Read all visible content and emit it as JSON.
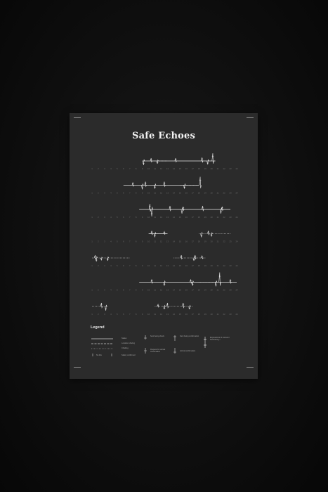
{
  "poster": {
    "title": "Safe Echoes",
    "background": "#2b2b2b",
    "ink": "#e8e8e8",
    "dim": "#6f6f6f"
  },
  "day_numbers": [
    "1",
    "2",
    "3",
    "4",
    "5",
    "6",
    "7",
    "8",
    "9",
    "10",
    "11",
    "12",
    "13",
    "14",
    "15",
    "16",
    "17",
    "18",
    "19",
    "20",
    "21",
    "22",
    "23",
    "24"
  ],
  "rows": [
    {
      "segments": [
        [
          9,
          20.6,
          "solid"
        ],
        [
          11,
          13,
          "dotted"
        ]
      ],
      "spikes": [
        [
          9.2,
          6
        ],
        [
          10.4,
          -4
        ],
        [
          11.4,
          4
        ],
        [
          14.3,
          -4
        ],
        [
          18.5,
          -5
        ],
        [
          19.4,
          5
        ],
        [
          20.2,
          -11
        ]
      ]
    },
    {
      "segments": [
        [
          6,
          18,
          "solid"
        ],
        [
          15,
          18,
          "dotted"
        ]
      ],
      "spikes": [
        [
          7.5,
          -4
        ],
        [
          9,
          6
        ],
        [
          9.5,
          -5
        ],
        [
          11,
          5
        ],
        [
          12.5,
          -5
        ],
        [
          15.7,
          5
        ],
        [
          18.2,
          -12
        ]
      ]
    },
    {
      "segments": [
        [
          8.5,
          23,
          "solid"
        ]
      ],
      "spikes": [
        [
          10.2,
          -8
        ],
        [
          10.5,
          10
        ],
        [
          13.4,
          -5
        ],
        [
          15.3,
          6
        ],
        [
          15.5,
          -4
        ],
        [
          18.6,
          -5
        ],
        [
          21.5,
          6
        ],
        [
          21.7,
          -4
        ]
      ]
    },
    {
      "segments": [
        [
          10,
          13,
          "solid"
        ],
        [
          18,
          23,
          "dotted"
        ]
      ],
      "spikes": [
        [
          10.5,
          -4
        ],
        [
          11,
          5
        ],
        [
          12.5,
          -3
        ],
        [
          18.4,
          5
        ],
        [
          19.5,
          -4
        ],
        [
          20,
          4
        ]
      ]
    },
    {
      "segments": [
        [
          1,
          7,
          "dotted"
        ],
        [
          14,
          19,
          "dotted"
        ]
      ],
      "spikes": [
        [
          1.5,
          -4
        ],
        [
          1.7,
          5
        ],
        [
          2.5,
          3
        ],
        [
          3.5,
          4
        ],
        [
          15.2,
          -4
        ],
        [
          17.2,
          4
        ],
        [
          17.4,
          -4
        ],
        [
          18.5,
          -3
        ]
      ]
    },
    {
      "segments": [
        [
          8.5,
          24,
          "solid"
        ],
        [
          18,
          21,
          "dotted"
        ]
      ],
      "spikes": [
        [
          10.5,
          -4
        ],
        [
          12.5,
          5
        ],
        [
          16.7,
          -4
        ],
        [
          17,
          5
        ],
        [
          20.7,
          6
        ],
        [
          21.3,
          -14
        ],
        [
          23,
          -4
        ]
      ]
    },
    {
      "segments": [
        [
          1,
          3.5,
          "dotted"
        ],
        [
          11,
          17,
          "dotted"
        ]
      ],
      "spikes": [
        [
          2.5,
          -5
        ],
        [
          3.2,
          6
        ],
        [
          11.5,
          -3
        ],
        [
          12.5,
          4
        ],
        [
          13,
          -5
        ],
        [
          15.5,
          -5
        ],
        [
          16.5,
          4
        ]
      ]
    }
  ],
  "legend": {
    "title": "Legend",
    "col1": [
      "Status",
      "Location sharing",
      "Chatting",
      "No link",
      "Safety confirmed"
    ],
    "col2": [
      "Sent being check",
      "Request for arrival confirmation"
    ],
    "col3": [
      "Sent being confirmation",
      "Arrival confirmation"
    ],
    "col4": [
      "Expressions of concern/ Numbering ≈"
    ]
  }
}
